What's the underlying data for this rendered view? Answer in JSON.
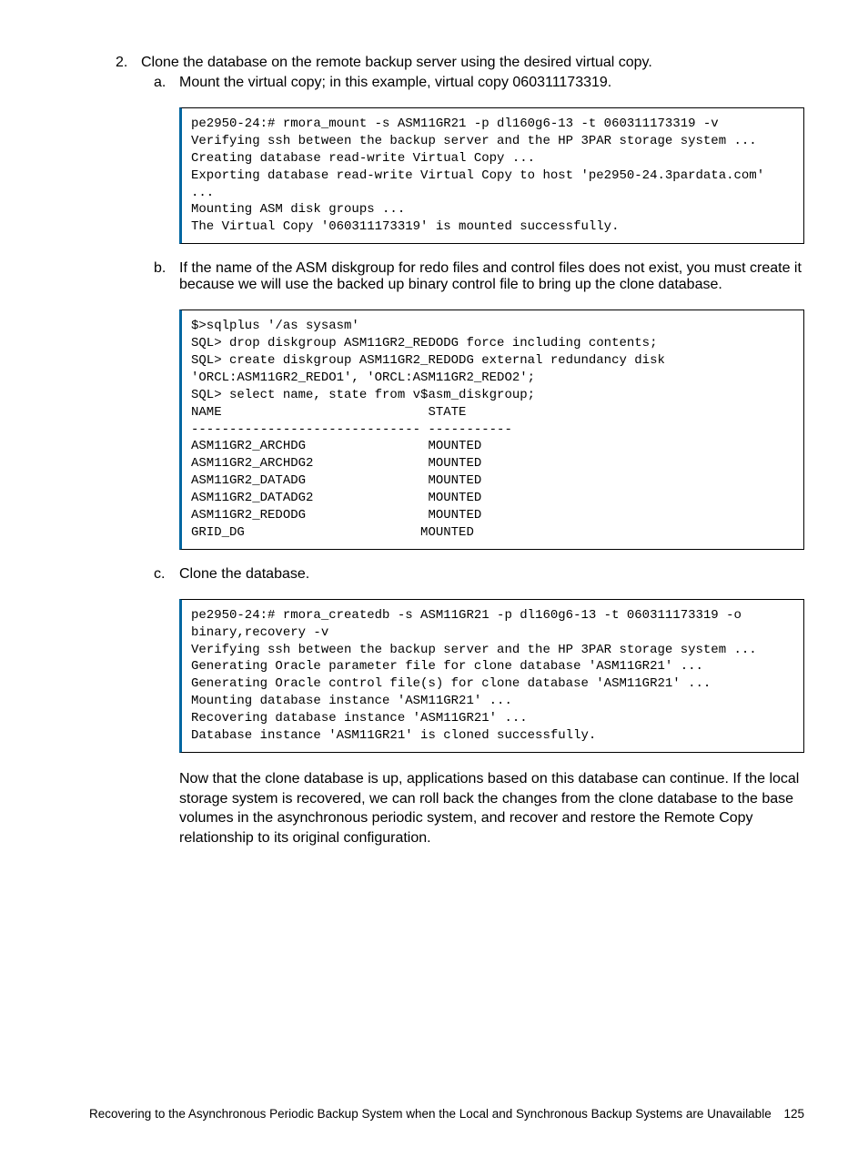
{
  "item2": {
    "number": "2.",
    "text": "Clone the database on the remote backup server using the desired virtual copy."
  },
  "sub_a": {
    "letter": "a.",
    "text": "Mount the virtual copy; in this example, virtual copy 060311173319."
  },
  "code_a": "pe2950-24:# rmora_mount -s ASM11GR21 -p dl160g6-13 -t 060311173319 -v\nVerifying ssh between the backup server and the HP 3PAR storage system ...\nCreating database read-write Virtual Copy ...\nExporting database read-write Virtual Copy to host 'pe2950-24.3pardata.com'\n...\nMounting ASM disk groups ...\nThe Virtual Copy '060311173319' is mounted successfully.",
  "sub_b": {
    "letter": "b.",
    "text": "If the name of the ASM diskgroup for redo files and control files does not exist, you must create it because we will use the backed up binary control file to bring up the clone database."
  },
  "code_b": "$>sqlplus '/as sysasm'\nSQL> drop diskgroup ASM11GR2_REDODG force including contents;\nSQL> create diskgroup ASM11GR2_REDODG external redundancy disk\n'ORCL:ASM11GR2_REDO1', 'ORCL:ASM11GR2_REDO2';\nSQL> select name, state from v$asm_diskgroup;\nNAME                           STATE\n------------------------------ -----------\nASM11GR2_ARCHDG                MOUNTED\nASM11GR2_ARCHDG2               MOUNTED\nASM11GR2_DATADG                MOUNTED\nASM11GR2_DATADG2               MOUNTED\nASM11GR2_REDODG                MOUNTED\nGRID_DG                       MOUNTED",
  "sub_c": {
    "letter": "c.",
    "text": "Clone the database."
  },
  "code_c": "pe2950-24:# rmora_createdb -s ASM11GR21 -p dl160g6-13 -t 060311173319 -o\nbinary,recovery -v\nVerifying ssh between the backup server and the HP 3PAR storage system ...\nGenerating Oracle parameter file for clone database 'ASM11GR21' ...\nGenerating Oracle control file(s) for clone database 'ASM11GR21' ...\nMounting database instance 'ASM11GR21' ...\nRecovering database instance 'ASM11GR21' ...\nDatabase instance 'ASM11GR21' is cloned successfully.",
  "para_after_c": "Now that the clone database is up, applications based on this database can continue. If the local storage system is recovered, we can roll back the changes from the clone database to the base volumes in the asynchronous periodic system, and recover and restore the Remote Copy relationship to its original configuration.",
  "footer": {
    "text": "Recovering to the Asynchronous Periodic Backup System when the Local and Synchronous Backup Systems are Unavailable",
    "page": "125"
  }
}
